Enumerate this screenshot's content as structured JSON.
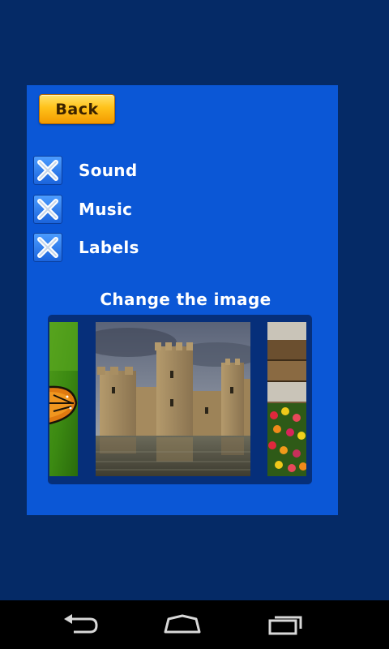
{
  "header": {
    "back_label": "Back"
  },
  "options": [
    {
      "label": "Sound",
      "checked": true
    },
    {
      "label": "Music",
      "checked": true
    },
    {
      "label": "Labels",
      "checked": true
    }
  ],
  "image_picker": {
    "title": "Change the image",
    "thumbnails": [
      "butterfly-image",
      "castle-image",
      "flowers-image"
    ]
  },
  "colors": {
    "background": "#052a66",
    "panel": "#0b57d6",
    "button": "#ffc21a"
  }
}
